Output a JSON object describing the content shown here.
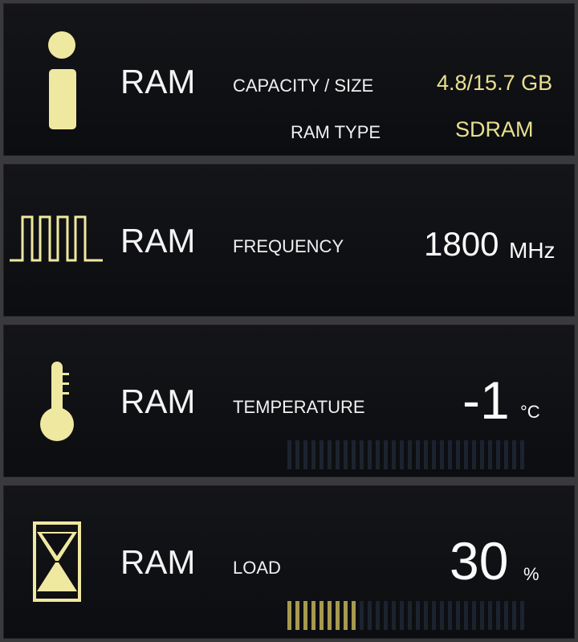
{
  "panels": {
    "capacity": {
      "title": "RAM",
      "label1": "CAPACITY / SIZE",
      "value1": "4.8/15.7 GB",
      "label2": "RAM TYPE",
      "value2": "SDRAM",
      "icon": "info-icon"
    },
    "frequency": {
      "title": "RAM",
      "label": "FREQUENCY",
      "value": "1800",
      "unit": "MHz",
      "icon": "square-wave-icon"
    },
    "temperature": {
      "title": "RAM",
      "label": "TEMPERATURE",
      "value": "-1",
      "unit": "°C",
      "icon": "thermometer-icon",
      "level": 0
    },
    "load": {
      "title": "RAM",
      "label": "LOAD",
      "value": "30",
      "unit": "%",
      "icon": "hourglass-icon",
      "level": 0.3
    }
  },
  "colors": {
    "accent": "#e8e08f",
    "bar_on": "#a79a4e",
    "bar_off": "#1c2330"
  },
  "bar_count": 30
}
